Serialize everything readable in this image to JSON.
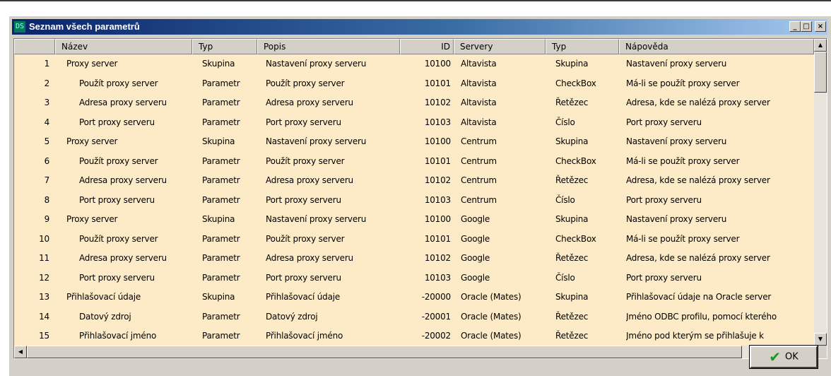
{
  "window": {
    "title": "Seznam všech parametrů",
    "icon_text": "DS",
    "controls": [
      "_",
      "□",
      "×"
    ]
  },
  "grid": {
    "columns": [
      "",
      "Název",
      "Typ",
      "Popis",
      "ID",
      "Servery",
      "Typ",
      "Nápověda"
    ],
    "rows": [
      [
        "1",
        "Proxy server",
        "Skupina",
        "Nastavení proxy serveru",
        "10100",
        "Altavista",
        "Skupina",
        "Nastavení proxy serveru"
      ],
      [
        "2",
        "Použít proxy server",
        "Parametr",
        "Použít proxy server",
        "10101",
        "Altavista",
        "CheckBox",
        "Má-li se použít proxy server"
      ],
      [
        "3",
        "Adresa proxy serveru",
        "Parametr",
        "Adresa proxy serveru",
        "10102",
        "Altavista",
        "Řetězec",
        "Adresa, kde se nalézá proxy server"
      ],
      [
        "4",
        "Port proxy serveru",
        "Parametr",
        "Port proxy serveru",
        "10103",
        "Altavista",
        "Číslo",
        "Port proxy serveru"
      ],
      [
        "5",
        "Proxy server",
        "Skupina",
        "Nastavení proxy serveru",
        "10100",
        "Centrum",
        "Skupina",
        "Nastavení proxy serveru"
      ],
      [
        "6",
        "Použít proxy server",
        "Parametr",
        "Použít proxy server",
        "10101",
        "Centrum",
        "CheckBox",
        "Má-li se použít proxy server"
      ],
      [
        "7",
        "Adresa proxy serveru",
        "Parametr",
        "Adresa proxy serveru",
        "10102",
        "Centrum",
        "Řetězec",
        "Adresa, kde se nalézá proxy server"
      ],
      [
        "8",
        "Port proxy serveru",
        "Parametr",
        "Port proxy serveru",
        "10103",
        "Centrum",
        "Číslo",
        "Port proxy serveru"
      ],
      [
        "9",
        "Proxy server",
        "Skupina",
        "Nastavení proxy serveru",
        "10100",
        "Google",
        "Skupina",
        "Nastavení proxy serveru"
      ],
      [
        "10",
        "Použít proxy server",
        "Parametr",
        "Použít proxy server",
        "10101",
        "Google",
        "CheckBox",
        "Má-li se použít proxy server"
      ],
      [
        "11",
        "Adresa proxy serveru",
        "Parametr",
        "Adresa proxy serveru",
        "10102",
        "Google",
        "Řetězec",
        "Adresa, kde se nalézá proxy server"
      ],
      [
        "12",
        "Port proxy serveru",
        "Parametr",
        "Port proxy serveru",
        "10103",
        "Google",
        "Číslo",
        "Port proxy serveru"
      ],
      [
        "13",
        "Přihlašovací údaje",
        "Skupina",
        "Přihlašovací údaje",
        "-20000",
        "Oracle (Mates)",
        "Skupina",
        "Přihlašovací údaje na Oracle server"
      ],
      [
        "14",
        "Datový zdroj",
        "Parametr",
        "Datový zdroj",
        "-20001",
        "Oracle (Mates)",
        "Řetězec",
        "Jméno ODBC profilu, pomocí kterého"
      ],
      [
        "15",
        "Přihlašovací jméno",
        "Parametr",
        "Přihlašovací jméno",
        "-20002",
        "Oracle (Mates)",
        "Řetězec",
        "Jméno pod kterým se přihlašuje k"
      ]
    ],
    "indented": [
      false,
      true,
      true,
      true,
      false,
      true,
      true,
      true,
      false,
      true,
      true,
      true,
      false,
      true,
      true
    ]
  },
  "footer": {
    "ok_label": "OK"
  },
  "colors": {
    "row_background": "#fdebc8",
    "dialog_face": "#d4d0c8",
    "titlebar_start": "#0a246a",
    "titlebar_end": "#a6caf0",
    "ok_check": "#1a9a1a"
  }
}
